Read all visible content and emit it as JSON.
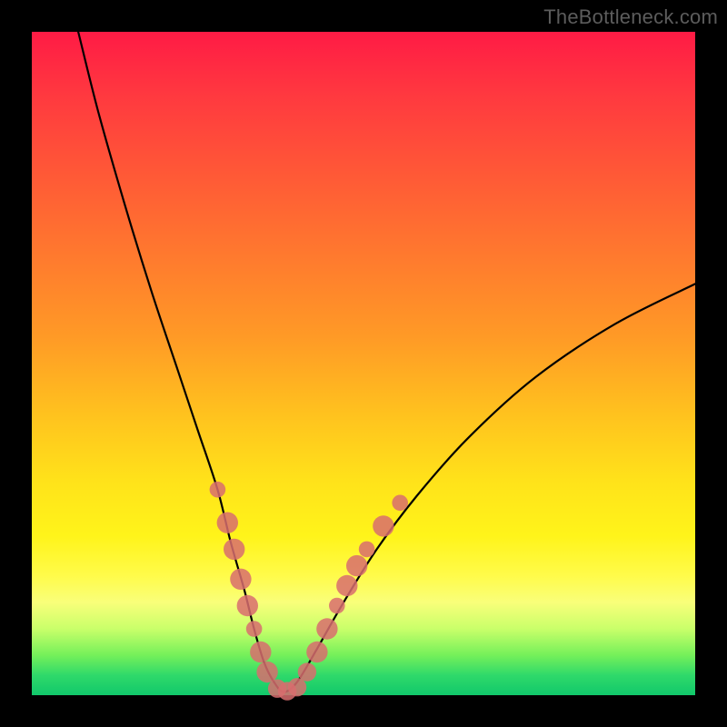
{
  "watermark": {
    "text": "TheBottleneck.com"
  },
  "chart_data": {
    "type": "line",
    "title": "",
    "xlabel": "",
    "ylabel": "",
    "xlim": [
      0,
      100
    ],
    "ylim": [
      0,
      100
    ],
    "series": [
      {
        "name": "curve",
        "x": [
          7,
          10,
          14,
          18,
          22,
          25,
          28,
          30,
          32,
          33.5,
          35,
          36.5,
          38,
          40,
          43,
          47,
          52,
          58,
          66,
          76,
          88,
          100
        ],
        "values": [
          100,
          88,
          74,
          61,
          49,
          40,
          31,
          23,
          16,
          10,
          5,
          2,
          0.5,
          2,
          7,
          14,
          22,
          30,
          39,
          48,
          56,
          62
        ]
      }
    ],
    "scatter": {
      "name": "dots",
      "color": "#d86d6f",
      "points": [
        {
          "x": 28.0,
          "y": 31.0,
          "r": 1.2
        },
        {
          "x": 29.5,
          "y": 26.0,
          "r": 1.6
        },
        {
          "x": 30.5,
          "y": 22.0,
          "r": 1.6
        },
        {
          "x": 31.5,
          "y": 17.5,
          "r": 1.6
        },
        {
          "x": 32.5,
          "y": 13.5,
          "r": 1.6
        },
        {
          "x": 33.5,
          "y": 10.0,
          "r": 1.2
        },
        {
          "x": 34.5,
          "y": 6.5,
          "r": 1.6
        },
        {
          "x": 35.5,
          "y": 3.5,
          "r": 1.6
        },
        {
          "x": 37.0,
          "y": 1.0,
          "r": 1.4
        },
        {
          "x": 38.5,
          "y": 0.6,
          "r": 1.4
        },
        {
          "x": 40.0,
          "y": 1.2,
          "r": 1.4
        },
        {
          "x": 41.5,
          "y": 3.5,
          "r": 1.4
        },
        {
          "x": 43.0,
          "y": 6.5,
          "r": 1.6
        },
        {
          "x": 44.5,
          "y": 10.0,
          "r": 1.6
        },
        {
          "x": 46.0,
          "y": 13.5,
          "r": 1.2
        },
        {
          "x": 47.5,
          "y": 16.5,
          "r": 1.6
        },
        {
          "x": 49.0,
          "y": 19.5,
          "r": 1.6
        },
        {
          "x": 50.5,
          "y": 22.0,
          "r": 1.2
        },
        {
          "x": 53.0,
          "y": 25.5,
          "r": 1.6
        },
        {
          "x": 55.5,
          "y": 29.0,
          "r": 1.2
        }
      ]
    },
    "gradient_stops": [
      {
        "pos": 0,
        "color": "#ff1b45"
      },
      {
        "pos": 22,
        "color": "#ff5a36"
      },
      {
        "pos": 46,
        "color": "#ff9a26"
      },
      {
        "pos": 68,
        "color": "#ffe31a"
      },
      {
        "pos": 86,
        "color": "#f9ff7a"
      },
      {
        "pos": 100,
        "color": "#11c86b"
      }
    ]
  }
}
